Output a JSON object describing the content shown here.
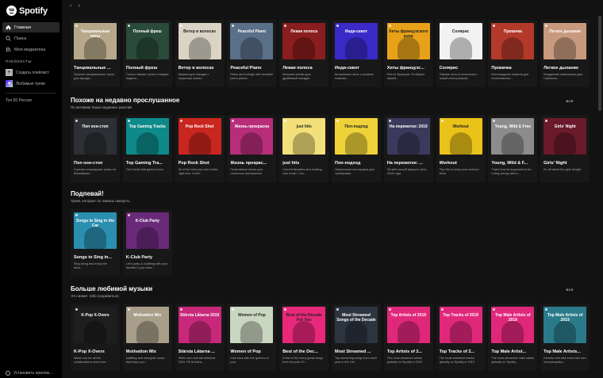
{
  "app": {
    "logo_text": "Spotify"
  },
  "sidebar": {
    "nav": [
      {
        "label": "Главная",
        "icon": "home-icon",
        "active": true
      },
      {
        "label": "Поиск",
        "icon": "search-icon",
        "active": false
      },
      {
        "label": "Моя медиатека",
        "icon": "library-icon",
        "active": false
      }
    ],
    "playlists_header": "ПЛЕЙЛИСТЫ",
    "create_playlist": "Создать плейлист",
    "liked_tracks": "Любимые треки",
    "playlists": [
      "Топ 50 Россия"
    ],
    "install_app": "Установить прилож..."
  },
  "sections": [
    {
      "title": "",
      "subtitle": "",
      "see_all": "",
      "cards": [
        {
          "title": "Танцевальные ...",
          "desc": "Лучшие танцевальные треки для заряда...",
          "cover_text": "Танцевальные хиты",
          "bg": "#b8a88a",
          "fg": "#fff"
        },
        {
          "title": "Полный фреш",
          "desc": "Только свежие треки в первую неделю...",
          "cover_text": "Полный фреш",
          "bg": "#2a4a3a",
          "fg": "#fff"
        },
        {
          "title": "Ветер в волосах",
          "desc": "Музыка для поездки с открытым окном...",
          "cover_text": "Ветер в волосах",
          "bg": "#d9d4c5",
          "fg": "#222"
        },
        {
          "title": "Peaceful Piano",
          "desc": "Relax and indulge with beautiful piano pieces",
          "cover_text": "Peaceful Piano",
          "bg": "#5a6f88",
          "fg": "#fff"
        },
        {
          "title": "Левая полоса",
          "desc": "Мощные ритмы для драйвовой поездки.",
          "cover_text": "Левая полоса",
          "bg": "#8a1d1d",
          "fg": "#fff"
        },
        {
          "title": "Инди-сквот",
          "desc": "Актуальные хиты и громкие новинки...",
          "cover_text": "Инди-сквот",
          "bg": "#3a2ac8",
          "fg": "#fff"
        },
        {
          "title": "Хиты французс...",
          "desc": "Рэп из Франции. Отобрано нашей...",
          "cover_text": "Хиты французского рэпа",
          "bg": "#e8a21a",
          "fg": "#222"
        },
        {
          "title": "Солярис",
          "desc": "Свежие хиты в сочетании с новой электроникой...",
          "cover_text": "Солярис",
          "bg": "#f2f2f2",
          "fg": "#222"
        },
        {
          "title": "Прокачка",
          "desc": "Беспощадная энергия для интенсивного...",
          "cover_text": "Прокачка",
          "bg": "#b33a2a",
          "fg": "#fff"
        },
        {
          "title": "Легкое дыхание",
          "desc": "Воздушная композиция для глубокого...",
          "cover_text": "Легкое дыхание",
          "bg": "#c79a7d",
          "fg": "#fff"
        }
      ]
    },
    {
      "title": "Похоже на недавно прослушанное",
      "subtitle": "По мотивам твоих недавних занятий.",
      "see_all": "ВСЕ",
      "cards": [
        {
          "title": "Поп нон-стоп",
          "desc": "Горячие популярные треки на ближайшее...",
          "cover_text": "Поп нон-стоп",
          "bg": "#2c2f33",
          "fg": "#fff"
        },
        {
          "title": "Top Gaming Tra...",
          "desc": "The tracks that gamers love.",
          "cover_text": "Top Gaming Tracks",
          "bg": "#0e8a8a",
          "fg": "#fff"
        },
        {
          "title": "Pop Rock Shot",
          "desc": "All of the best pop rock tracks right now. Cover...",
          "cover_text": "Pop Rock Shot",
          "bg": "#c9261f",
          "fg": "#fff"
        },
        {
          "title": "Жизнь прекрас...",
          "desc": "Позитивные песни для отличного настроения.",
          "cover_text": "Жизнь прекрасна",
          "bg": "#b82d7a",
          "fg": "#fff"
        },
        {
          "title": "just hits",
          "desc": "Current favorites and exciting new music. Cov...",
          "cover_text": "just hits",
          "bg": "#f3e07a",
          "fg": "#222"
        },
        {
          "title": "Поп-подход",
          "desc": "Энергичная поп-музыка для тренировки.",
          "cover_text": "Поп-подход",
          "bg": "#efd23a",
          "fg": "#222"
        },
        {
          "title": "На перемотке: ...",
          "desc": "Легкий способ вернуть хиты 2019 года.",
          "cover_text": "На перемотке: 2019",
          "bg": "#3b3a5c",
          "fg": "#fff"
        },
        {
          "title": "Workout",
          "desc": "Pop hits to keep your workout fresh.",
          "cover_text": "Workout",
          "bg": "#e9c21a",
          "fg": "#222"
        },
        {
          "title": "Young, Wild & F...",
          "desc": "That's how its supposed to be. Living young, wild a...",
          "cover_text": "Young, Wild & Free",
          "bg": "#8c8c8c",
          "fg": "#fff"
        },
        {
          "title": "Girls' Night",
          "desc": "It's all about the girls tonight.",
          "cover_text": "Girls' Night",
          "bg": "#6a1a2a",
          "fg": "#fff"
        }
      ]
    },
    {
      "title": "Подпевай!",
      "subtitle": "Треки, которые ты знаешь наизусть.",
      "see_all": "",
      "cards": [
        {
          "title": "Songs to Sing in...",
          "desc": "Sing along and enjoy the drive...",
          "cover_text": "Songs to Sing in the Car",
          "bg": "#2b8fb0",
          "fg": "#fff"
        },
        {
          "title": "K-Club Party",
          "desc": "Let's party & clubbing with your favorite K-pop danc...",
          "cover_text": "K-Club Party",
          "bg": "#6a2a7a",
          "fg": "#fff"
        }
      ]
    },
    {
      "title": "Больше любимой музыки",
      "subtitle": "Это может тебе понравиться.",
      "see_all": "ВСЕ",
      "cards": [
        {
          "title": "K-Pop X-Overs",
          "desc": "Watch our for all the collaborations and inner...",
          "cover_text": "K-Pop X-Overs",
          "bg": "#1e1e1e",
          "fg": "#fff"
        },
        {
          "title": "Motivation Mix",
          "desc": "Uplifting and energetic music that helps you...",
          "cover_text": "Motivation Mix",
          "bg": "#a89e8a",
          "fg": "#fff"
        },
        {
          "title": "Stärsta Låtarna ...",
          "desc": "Hitlen som satt sitt definiera 2019. På lä-Estra...",
          "cover_text": "Största Låtarna 2019",
          "bg": "#c8287a",
          "fg": "#fff"
        },
        {
          "title": "Women of Pop",
          "desc": "Kick back with the queens of pop.",
          "cover_text": "Women of Pop",
          "bg": "#c9d6c0",
          "fg": "#222"
        },
        {
          "title": "Best of the Dec...",
          "desc": "A few of the many great songs from the past 10...",
          "cover_text": "Best of the Decade For You",
          "bg": "#e8287a",
          "fg": "#222"
        },
        {
          "title": "Most Streamed ...",
          "desc": "Top streaming songs from each year in the 10s.",
          "cover_text": "Most Streamed Songs of the Decade",
          "bg": "#2c3440",
          "fg": "#fff"
        },
        {
          "title": "Top Artists of 2...",
          "desc": "The most-streamed artists globally on Spotify in 2019",
          "cover_text": "Top Artists of 2019",
          "bg": "#e0287a",
          "fg": "#fff"
        },
        {
          "title": "Top Tracks of 2...",
          "desc": "The most-streamed tracks globally on Spotify in 2019",
          "cover_text": "Top Tracks of 2019",
          "bg": "#e0287a",
          "fg": "#fff"
        },
        {
          "title": "Top Male Artist...",
          "desc": "The most-streamed male artists globally on Spotify...",
          "cover_text": "Top Male Artists of 2019",
          "bg": "#e0287a",
          "fg": "#fff"
        },
        {
          "title": "Top Male Artists...",
          "desc": "Derelan erik elka erda tokni een menyampaika...",
          "cover_text": "Top Male Artists of 2019",
          "bg": "#2a7a8a",
          "fg": "#fff"
        }
      ]
    }
  ]
}
